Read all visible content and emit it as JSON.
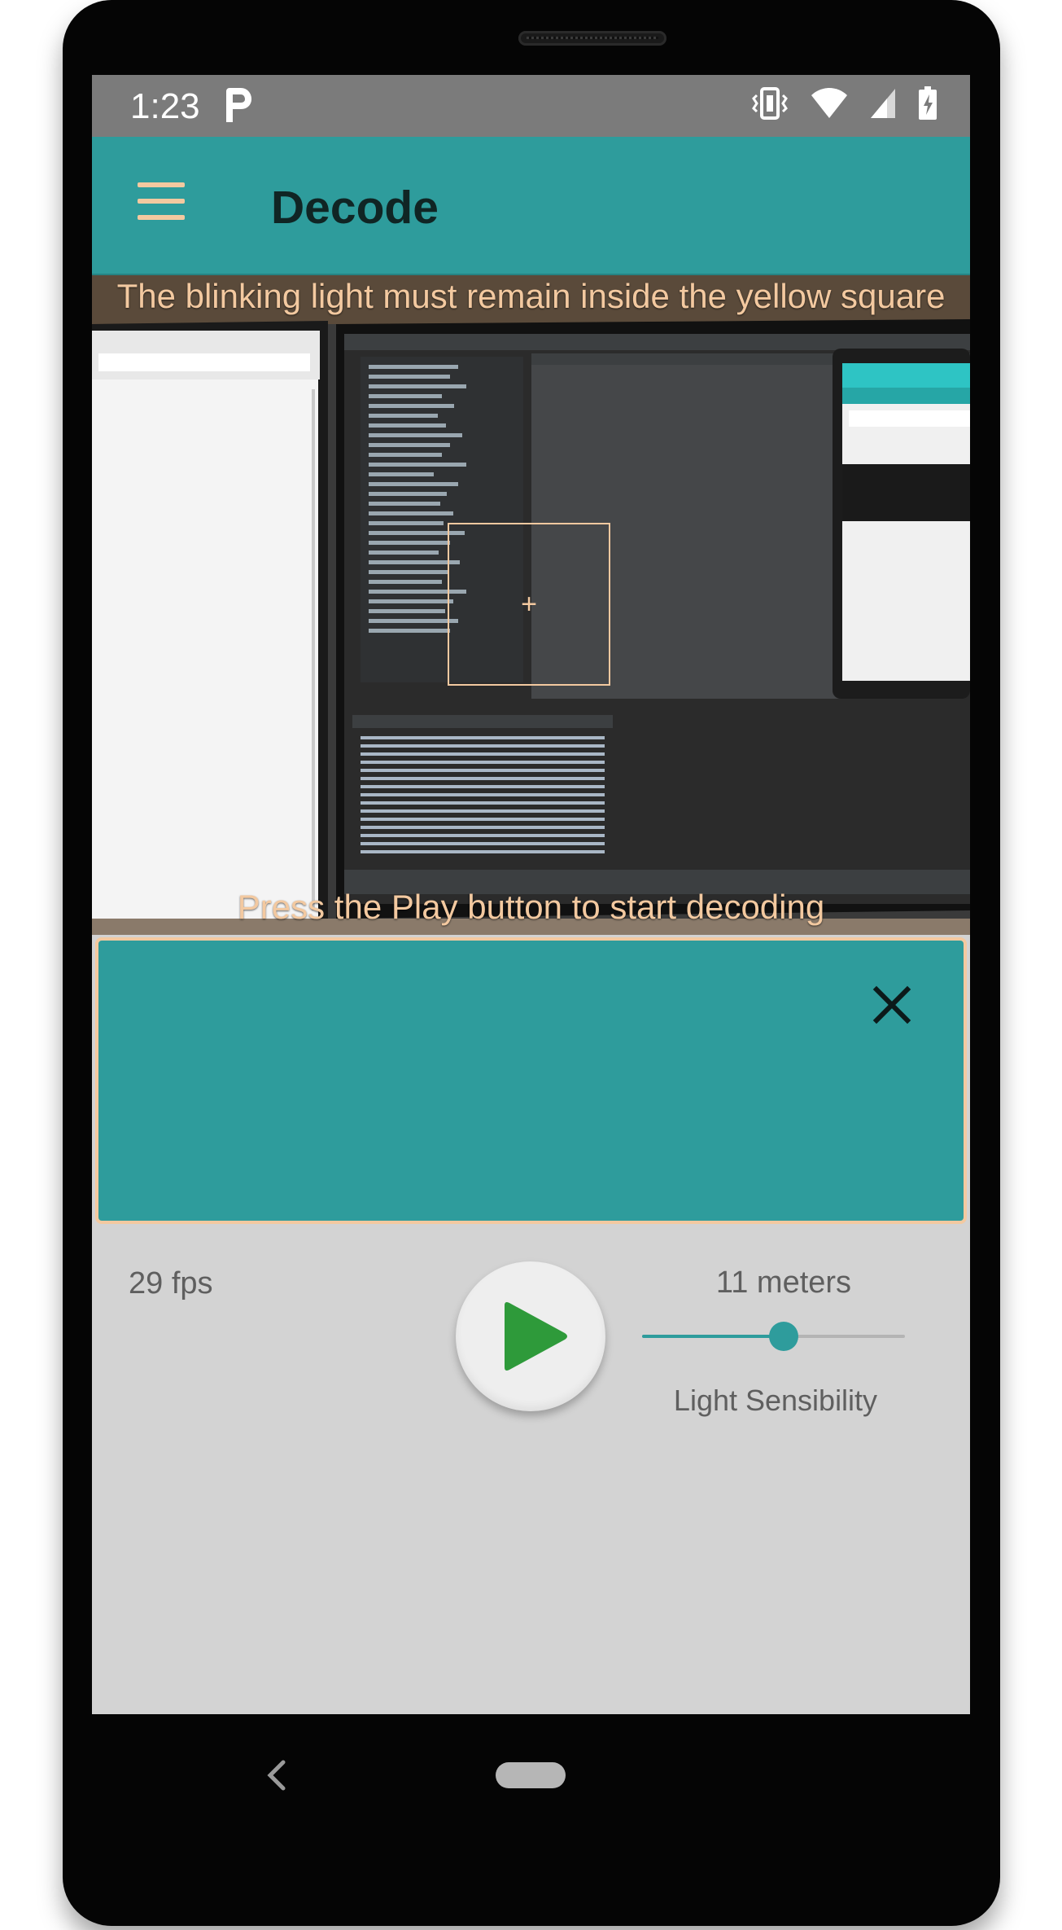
{
  "status_bar": {
    "time": "1:23",
    "app_icon": "p-letter-icon",
    "icons": [
      "vibrate-icon",
      "wifi-icon",
      "cell-signal-icon",
      "battery-charging-icon"
    ]
  },
  "app_bar": {
    "menu_icon": "hamburger-menu-icon",
    "title": "Decode"
  },
  "camera": {
    "hint_top": "The blinking light must remain inside the yellow square",
    "hint_bottom": "Press the Play button to start decoding",
    "target_marker": "+"
  },
  "output": {
    "text": "",
    "close_icon": "close-icon"
  },
  "controls": {
    "fps": "29 fps",
    "play_icon": "play-icon",
    "distance": "11 meters",
    "sensibility_label": "Light Sensibility",
    "sensibility_level": 0.54
  },
  "colors": {
    "accent": "#2e9c9c",
    "highlight": "#f3c9a0",
    "play": "#2e9a3a",
    "background": "#d3d3d3"
  }
}
